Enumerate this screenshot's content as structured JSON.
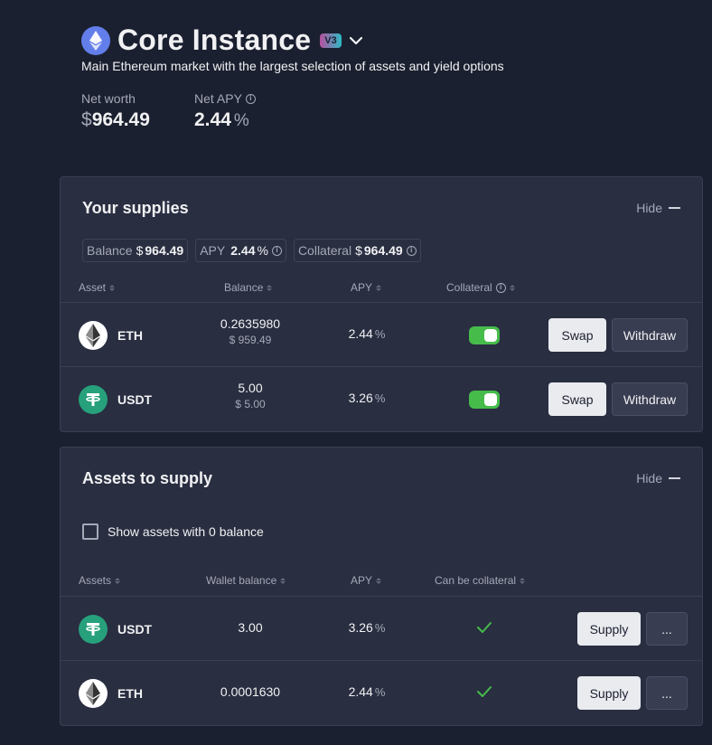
{
  "header": {
    "title": "Core Instance",
    "version_badge": "V3",
    "subtitle": "Main Ethereum market with the largest selection of assets and yield options",
    "net_worth_label": "Net worth",
    "net_worth_symbol": "$",
    "net_worth_value": "964.49",
    "net_apy_label": "Net APY",
    "net_apy_value": "2.44",
    "net_apy_unit": "%"
  },
  "supplies": {
    "title": "Your supplies",
    "hide_label": "Hide",
    "chips": {
      "balance_label": "Balance",
      "balance_symbol": "$",
      "balance_value": "964.49",
      "apy_label": "APY",
      "apy_value": "2.44",
      "apy_unit": "%",
      "collateral_label": "Collateral",
      "collateral_symbol": "$",
      "collateral_value": "964.49"
    },
    "columns": [
      "Asset",
      "Balance",
      "APY",
      "Collateral"
    ],
    "rows": [
      {
        "asset": "ETH",
        "balance": "0.2635980",
        "balance_usd_symbol": "$",
        "balance_usd": "959.49",
        "apy": "2.44",
        "apy_unit": "%",
        "collateral": true,
        "swap_label": "Swap",
        "withdraw_label": "Withdraw"
      },
      {
        "asset": "USDT",
        "balance": "5.00",
        "balance_usd_symbol": "$",
        "balance_usd": "5.00",
        "apy": "3.26",
        "apy_unit": "%",
        "collateral": true,
        "swap_label": "Swap",
        "withdraw_label": "Withdraw"
      }
    ]
  },
  "assets_to_supply": {
    "title": "Assets to supply",
    "hide_label": "Hide",
    "checkbox_label": "Show assets with 0 balance",
    "checkbox_checked": false,
    "columns": [
      "Assets",
      "Wallet balance",
      "APY",
      "Can be collateral"
    ],
    "rows": [
      {
        "asset": "USDT",
        "wallet_balance": "3.00",
        "apy": "3.26",
        "apy_unit": "%",
        "can_be_collateral": true,
        "supply_label": "Supply",
        "more_label": "..."
      },
      {
        "asset": "ETH",
        "wallet_balance": "0.0001630",
        "apy": "2.44",
        "apy_unit": "%",
        "can_be_collateral": true,
        "supply_label": "Supply",
        "more_label": "..."
      }
    ]
  },
  "colors": {
    "background": "#1b2030",
    "panel": "#292e41",
    "toggle_on": "#46bc4b",
    "check": "#46bc4b",
    "eth_brand": "#627eea",
    "usdt_brand": "#26a17b"
  }
}
